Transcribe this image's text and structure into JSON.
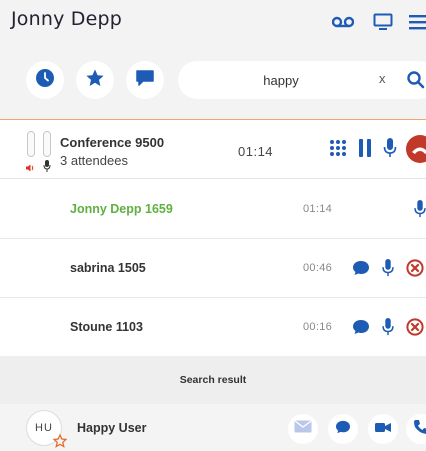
{
  "header": {
    "user_name": "Jonny Depp",
    "icons": [
      "voicemail-icon",
      "monitor-icon",
      "hamburger-menu-icon"
    ]
  },
  "toolbar": {
    "buttons": [
      "history-clock-icon",
      "favorites-star-icon",
      "chat-bubble-icon"
    ],
    "search": {
      "value": "happy",
      "clear_label": "x"
    }
  },
  "conference": {
    "title": "Conference 9500",
    "attendees": "3 attendees",
    "duration": "01:14"
  },
  "participants": [
    {
      "name": "Jonny Depp 1659",
      "time": "01:14",
      "active": true
    },
    {
      "name": "sabrina 1505",
      "time": "00:46",
      "active": false
    },
    {
      "name": "Stoune 1103",
      "time": "00:16",
      "active": false
    }
  ],
  "search_section": {
    "label": "Search result"
  },
  "contact": {
    "initials": "HU",
    "name": "Happy User"
  },
  "colors": {
    "accent": "#1e5bb5",
    "hangup": "#c0392b",
    "active_name": "#5fb040",
    "divider": "#f4a576",
    "action_pale": "#b9c8ea"
  }
}
